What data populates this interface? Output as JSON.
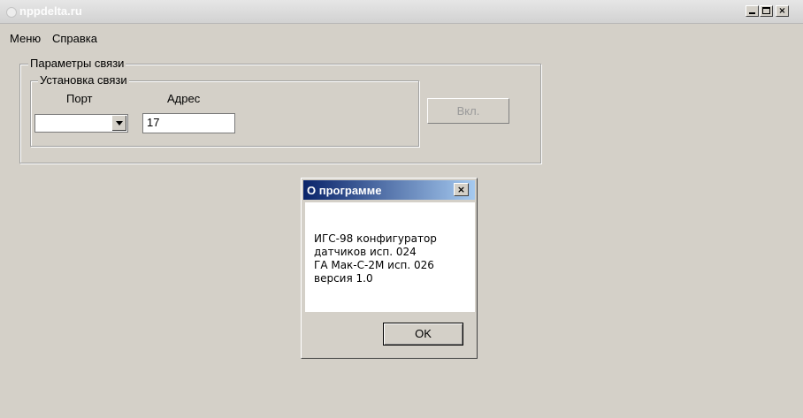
{
  "window": {
    "title": "nppdelta.ru",
    "controls": {
      "minimize": "_",
      "maximize": "□",
      "close": "×"
    }
  },
  "menu": {
    "items": [
      "Меню",
      "Справка"
    ]
  },
  "params_group": {
    "title": "Параметры связи",
    "connection_group": {
      "title": "Установка связи",
      "port_label": "Порт",
      "port_value": "",
      "address_label": "Адрес",
      "address_value": "17"
    },
    "connect_button": "Вкл."
  },
  "about_dialog": {
    "title": "О программе",
    "close": "×",
    "text": "ИГС-98 конфигуратор\nдатчиков исп. 024\nГА Мак-С-2М исп. 026\nверсия 1.0",
    "ok_button": "OK"
  },
  "icons": {
    "app": "app-icon",
    "combo": "chevron-down-icon"
  },
  "colors": {
    "background": "#d4d0c8",
    "dialog_title_start": "#0a246a",
    "dialog_title_end": "#a6caf0"
  }
}
